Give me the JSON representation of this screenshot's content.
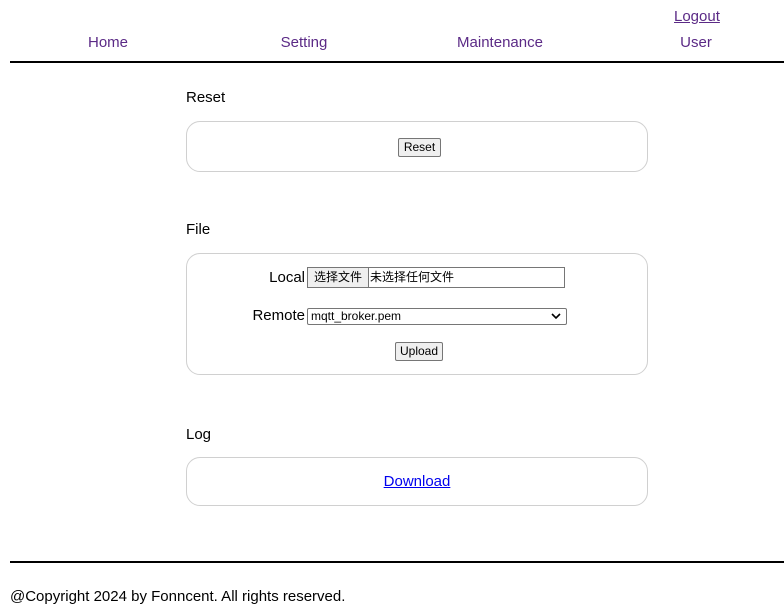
{
  "header": {
    "logout_label": "Logout",
    "nav": [
      "Home",
      "Setting",
      "Maintenance",
      "User"
    ]
  },
  "reset_section": {
    "title": "Reset",
    "button_label": "Reset"
  },
  "file_section": {
    "title": "File",
    "local_label": "Local",
    "choose_button_label": "选择文件",
    "file_status": "未选择任何文件",
    "remote_label": "Remote",
    "remote_selected": "mqtt_broker.pem",
    "upload_label": "Upload"
  },
  "log_section": {
    "title": "Log",
    "download_label": "Download"
  },
  "footer": {
    "copyright": "@Copyright 2024 by Fonncent. All rights reserved."
  },
  "colors": {
    "nav_link": "#5b2a86",
    "download_link": "#0000ee",
    "box_border": "#d0d0d0"
  }
}
